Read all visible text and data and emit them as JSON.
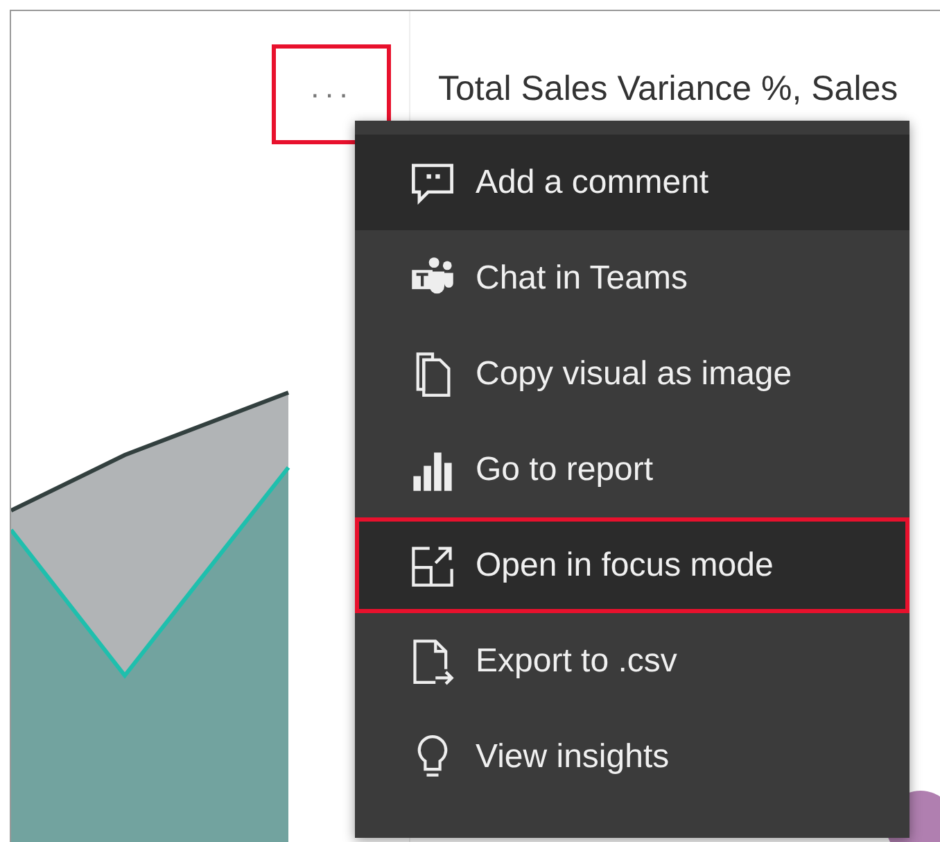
{
  "more_button": {
    "label": "···",
    "highlighted": true
  },
  "visual": {
    "title": "Total Sales Variance %, Sales"
  },
  "menu": {
    "items": [
      {
        "kind": "comment",
        "label": "Add a comment",
        "hovered": true,
        "highlighted": false
      },
      {
        "kind": "teams",
        "label": "Chat in Teams",
        "hovered": false,
        "highlighted": false
      },
      {
        "kind": "copy",
        "label": "Copy visual as image",
        "hovered": false,
        "highlighted": false
      },
      {
        "kind": "report",
        "label": "Go to report",
        "hovered": false,
        "highlighted": false
      },
      {
        "kind": "focus",
        "label": "Open in focus mode",
        "hovered": true,
        "highlighted": true
      },
      {
        "kind": "export",
        "label": "Export to .csv",
        "hovered": false,
        "highlighted": false
      },
      {
        "kind": "insights",
        "label": "View insights",
        "hovered": false,
        "highlighted": false
      }
    ]
  }
}
